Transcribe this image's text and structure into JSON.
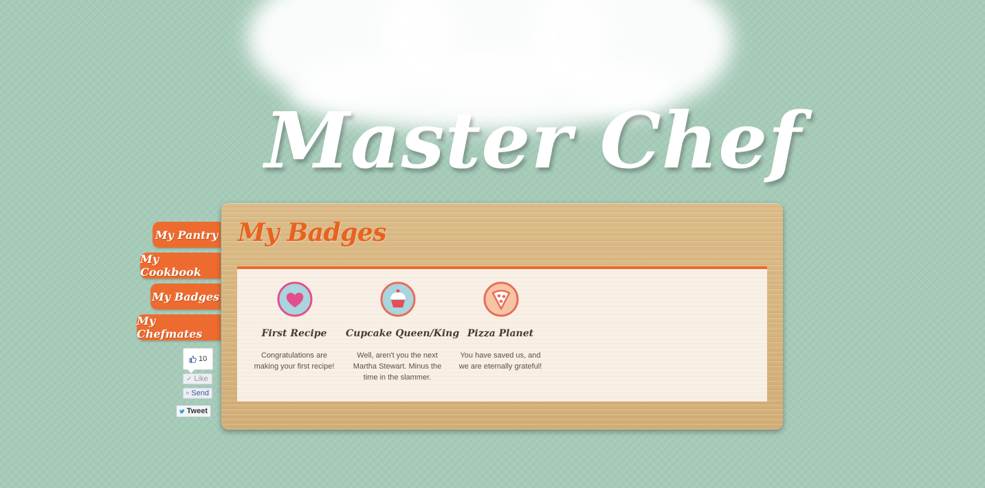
{
  "site": {
    "logo_text": "Master Chef"
  },
  "nav": {
    "items": [
      {
        "label": "My Pantry"
      },
      {
        "label": "My Cookbook"
      },
      {
        "label": "My Badges"
      },
      {
        "label": "My Chefmates"
      }
    ]
  },
  "social": {
    "like_count": "10",
    "like_label": "Like",
    "send_label": "Send",
    "tweet_label": "Tweet"
  },
  "main": {
    "title": "My Badges",
    "badges": [
      {
        "name": "First Recipe",
        "description": "Congratulations are making your first recipe!",
        "icon": "heart-icon"
      },
      {
        "name": "Cupcake Queen/King",
        "description": "Well, aren't you the next Martha Stewart. Minus the time in the slammer.",
        "icon": "cupcake-icon"
      },
      {
        "name": "Pizza Planet",
        "description": "You have saved us, and we are eternally grateful!",
        "icon": "pizza-icon"
      }
    ]
  },
  "colors": {
    "background": "#a6cbb9",
    "accent_orange": "#ee6b2f",
    "badge_blue": "#a9d5de",
    "badge_pink": "#e44e8d",
    "badge_coral": "#e96b5a"
  }
}
